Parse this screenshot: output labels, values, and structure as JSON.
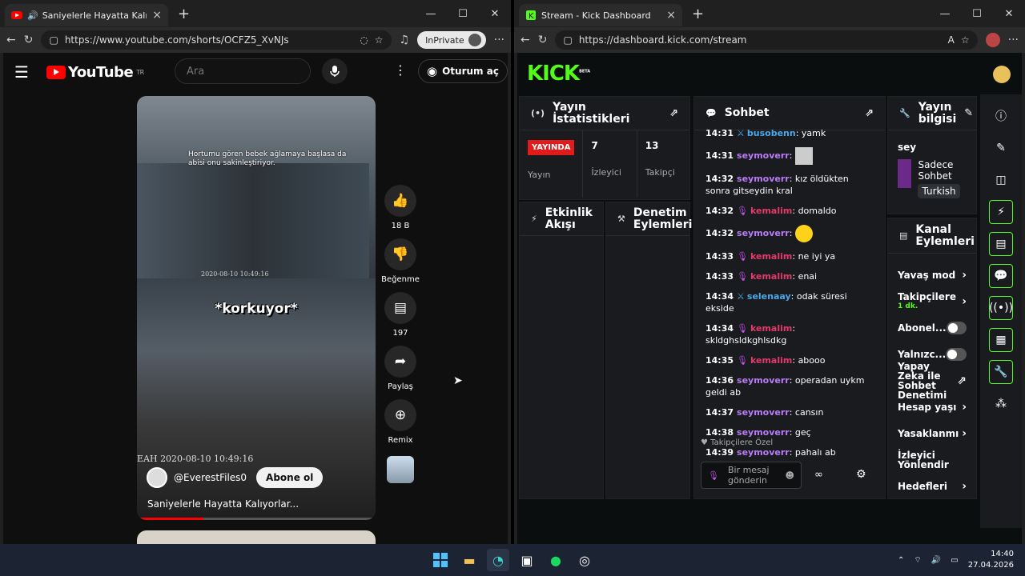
{
  "left": {
    "tab_title": "Saniyelerle Hayatta Kalıyorlar...",
    "url": "https://www.youtube.com/shorts/OCFZ5_XvNJs",
    "inprivate": "InPrivate",
    "yt": {
      "logo": "YouTube",
      "region": "TR",
      "search_placeholder": "Ara",
      "signin": "Oturum aç",
      "caption": "Hortumu gören bebek ağlamaya başlasa da abisi onu sakinleştiriyor.",
      "stamp1": "2020-08-10  10:49:16",
      "overlay": "*korkuyor*",
      "stamp2": "EAH  2020-08-10  10:49:16",
      "channel": "@EverestFiles0",
      "subscribe": "Abone ol",
      "title": "Saniyelerle Hayatta Kalıyorlar...",
      "likes": "18 B",
      "dislike": "Beğenme",
      "comments": "197",
      "share": "Paylaş",
      "remix": "Remix",
      "progress": 0.28
    }
  },
  "right": {
    "tab_title": "Stream - Kick Dashboard",
    "url": "https://dashboard.kick.com/stream",
    "logo": "KICK",
    "logo_sup": "BETA",
    "stats_title": "Yayın İstatistikleri",
    "live": "YAYINDA",
    "stats": [
      {
        "value": "7",
        "label": "İzleyici"
      },
      {
        "value": "13",
        "label": "Takipçi"
      }
    ],
    "stream_label": "Yayın",
    "activity_title": "Etkinlik Akışı",
    "mod_title": "Denetim Eylemleri",
    "chat_title": "Sohbet",
    "chat": [
      {
        "t": "14:31",
        "u": "busobenn",
        "m": "yamk",
        "badge": "mod",
        "color": "#4aa8e8"
      },
      {
        "t": "14:31",
        "u": "seymoverr",
        "m": "",
        "emote": "img",
        "color": "#b97cf6"
      },
      {
        "t": "14:32",
        "u": "seymoverr",
        "m": "kız öldükten sonra gitseydin kral",
        "color": "#b97cf6"
      },
      {
        "t": "14:32",
        "u": "kemalim",
        "m": "domaldo",
        "badge": "mic",
        "color": "#e23a6b"
      },
      {
        "t": "14:32",
        "u": "seymoverr",
        "m": "",
        "emote": "emo",
        "color": "#b97cf6"
      },
      {
        "t": "14:33",
        "u": "kemalim",
        "m": "ne iyi ya",
        "badge": "mic",
        "color": "#e23a6b"
      },
      {
        "t": "14:33",
        "u": "kemalim",
        "m": "enai",
        "badge": "mic",
        "color": "#e23a6b"
      },
      {
        "t": "14:34",
        "u": "selenaay",
        "m": "odak süresi ekside",
        "badge": "mod",
        "color": "#4aa8e8"
      },
      {
        "t": "14:34",
        "u": "kemalim",
        "m": "skldghsldkghlsdkg",
        "badge": "mic",
        "color": "#e23a6b"
      },
      {
        "t": "14:35",
        "u": "kemalim",
        "m": "abooo",
        "badge": "mic",
        "color": "#e23a6b"
      },
      {
        "t": "14:36",
        "u": "seymoverr",
        "m": "operadan uykm geldi ab",
        "color": "#b97cf6"
      },
      {
        "t": "14:37",
        "u": "seymoverr",
        "m": "cansın",
        "color": "#b97cf6"
      },
      {
        "t": "14:38",
        "u": "seymoverr",
        "m": "geç",
        "color": "#b97cf6"
      },
      {
        "t": "14:39",
        "u": "seymoverr",
        "m": "pahalı ab",
        "color": "#b97cf6"
      }
    ],
    "followers_only": "Takipçilere Özel",
    "chat_placeholder": "Bir mesaj gönderin",
    "info_title": "Yayın bilgisi",
    "info_name": "sey",
    "info_category": "Sadece Sohbet",
    "info_lang": "Turkish",
    "channel_actions_title": "Kanal Eylemleri",
    "actions": [
      {
        "label": "Yavaş mod",
        "kind": "chev"
      },
      {
        "label": "Takipçilere",
        "sub": "1 dk.",
        "kind": "chev"
      },
      {
        "label": "Abonel...",
        "kind": "toggle"
      },
      {
        "label": "Yalnızc...",
        "kind": "toggle"
      },
      {
        "label": "Yapay Zeka ile Sohbet Denetimi",
        "kind": "ext"
      },
      {
        "label": "Hesap yaşı",
        "kind": "chev"
      },
      {
        "label": "Yasaklanmı",
        "kind": "chev"
      },
      {
        "label": "İzleyici Yönlendir",
        "kind": "none"
      },
      {
        "label": "Hedefleri",
        "kind": "chev"
      }
    ]
  },
  "taskbar": {
    "time": "14:40",
    "date": "27.04.2026"
  }
}
